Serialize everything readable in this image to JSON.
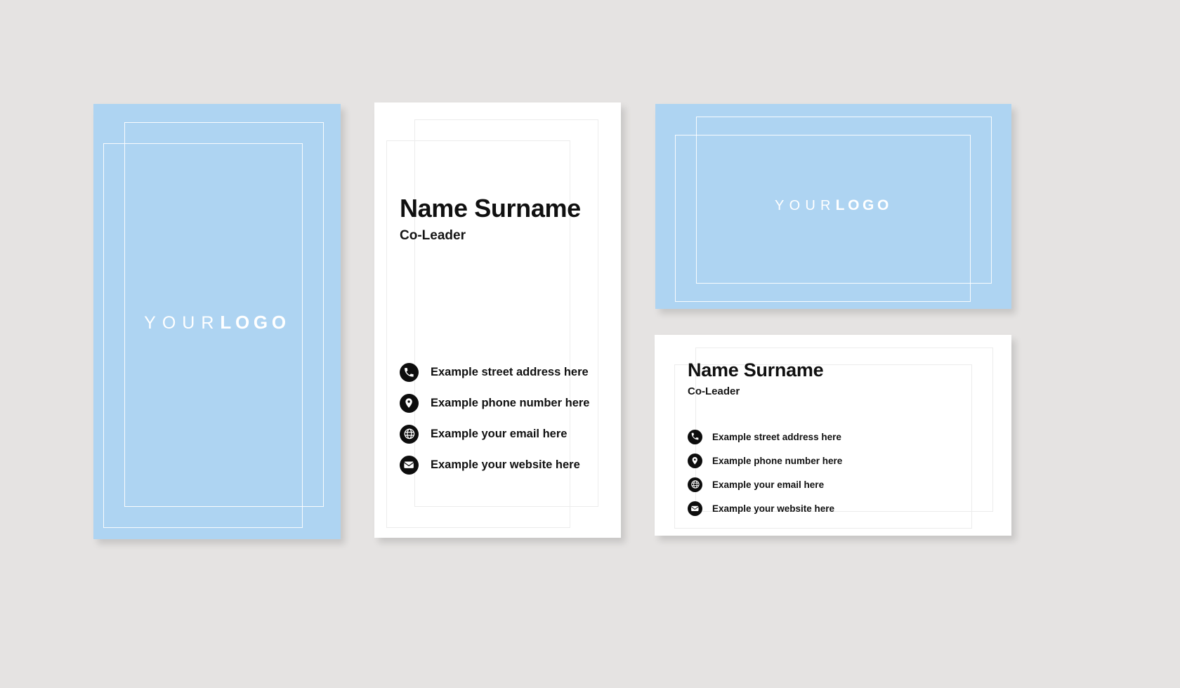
{
  "canvas": {
    "background_color": "#e5e3e2",
    "brand_blue": "#aed4f2",
    "ink": "#101010"
  },
  "logo": {
    "thin_part": "YOUR",
    "bold_part": "LOGO"
  },
  "identity": {
    "name": "Name Surname",
    "role": "Co-Leader"
  },
  "contacts": [
    {
      "icon": "phone-icon",
      "label": "Example street address here"
    },
    {
      "icon": "location-icon",
      "label": "Example phone number here"
    },
    {
      "icon": "globe-icon",
      "label": "Example your email here"
    },
    {
      "icon": "envelope-icon",
      "label": "Example your website here"
    }
  ],
  "cards": {
    "back_vertical": {
      "name": "back-vertical-card",
      "surface": "blue"
    },
    "front_vertical": {
      "name": "front-vertical-card",
      "surface": "white"
    },
    "back_horizontal": {
      "name": "back-horizontal-card",
      "surface": "blue"
    },
    "front_horizontal": {
      "name": "front-horizontal-card",
      "surface": "white"
    }
  }
}
